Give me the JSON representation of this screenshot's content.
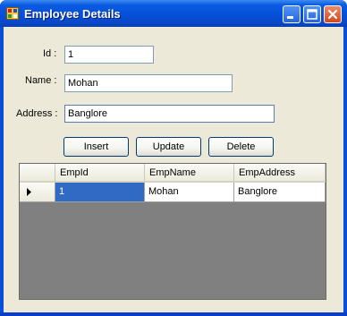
{
  "window": {
    "title": "Employee Details",
    "icon": "app-form-icon"
  },
  "form": {
    "id_label": "Id :",
    "id_value": "1",
    "name_label": "Name :",
    "name_value": "Mohan",
    "address_label": "Address :",
    "address_value": "Banglore"
  },
  "buttons": {
    "insert": "Insert",
    "update": "Update",
    "delete": "Delete"
  },
  "grid": {
    "columns": [
      "EmpId",
      "EmpName",
      "EmpAddress"
    ],
    "rows": [
      [
        "1",
        "Mohan",
        "Banglore"
      ]
    ],
    "selected_row": 0,
    "selected_cell_color": "#316ac5"
  },
  "colors": {
    "titlebar": "#0550d8",
    "client_background": "#ece9d8",
    "grid_background": "#808080"
  }
}
